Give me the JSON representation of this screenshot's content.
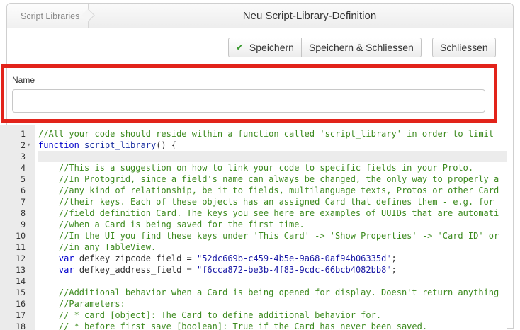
{
  "breadcrumb": {
    "label": "Script Libraries"
  },
  "window_title": "Neu Script-Library-Definition",
  "toolbar": {
    "save_label": "Speichern",
    "save_close_label": "Speichern & Schliessen",
    "close_label": "Schliessen"
  },
  "name_field": {
    "label": "Name",
    "value": "",
    "placeholder": ""
  },
  "editor": {
    "lines": [
      {
        "n": "1",
        "fold": "",
        "text": "//All your code should reside within a function called 'script_library' in order to limit"
      },
      {
        "n": "2",
        "fold": "▾",
        "text": "function script_library() {"
      },
      {
        "n": "3",
        "fold": "",
        "text": ""
      },
      {
        "n": "4",
        "fold": "",
        "text": "    //This is a suggestion on how to link your code to specific fields in your Proto."
      },
      {
        "n": "5",
        "fold": "",
        "text": "    //In Protogrid, since a field's name can always be changed, the only way to properly a"
      },
      {
        "n": "6",
        "fold": "",
        "text": "    //any kind of relationship, be it to fields, multilanguage texts, Protos or other Card"
      },
      {
        "n": "7",
        "fold": "",
        "text": "    //their keys. Each of these objects has an assigned Card that defines them - e.g. for"
      },
      {
        "n": "8",
        "fold": "",
        "text": "    //field definition Card. The keys you see here are examples of UUIDs that are automati"
      },
      {
        "n": "9",
        "fold": "",
        "text": "    //when a Card is being saved for the first time."
      },
      {
        "n": "10",
        "fold": "",
        "text": "    //In the UI you find these keys under 'This Card' -> 'Show Properties' -> 'Card ID' or"
      },
      {
        "n": "11",
        "fold": "",
        "text": "    //in any TableView."
      },
      {
        "n": "12",
        "fold": "",
        "text": "    var defkey_zipcode_field = \"52dc669b-c459-4b5e-9a68-0af94b06335d\";"
      },
      {
        "n": "13",
        "fold": "",
        "text": "    var defkey_address_field = \"f6cca872-be3b-4f83-9cdc-66bcb4082bb8\";"
      },
      {
        "n": "14",
        "fold": "",
        "text": ""
      },
      {
        "n": "15",
        "fold": "",
        "text": "    //Additional behavior when a Card is being opened for display. Doesn't return anything"
      },
      {
        "n": "16",
        "fold": "",
        "text": "    //Parameters:"
      },
      {
        "n": "17",
        "fold": "",
        "text": "    // * card [object]: The Card to define additional behavior for."
      },
      {
        "n": "18",
        "fold": "",
        "text": "    // * before_first_save [boolean]: True if the Card has never been saved."
      }
    ]
  },
  "colors": {
    "highlight_frame": "#e2231a",
    "check_icon": "#3a9a2f",
    "comment": "#3c8a1e",
    "keyword": "#0000cc",
    "string": "#1a1aa6"
  },
  "icons": {
    "save": "check-icon"
  }
}
